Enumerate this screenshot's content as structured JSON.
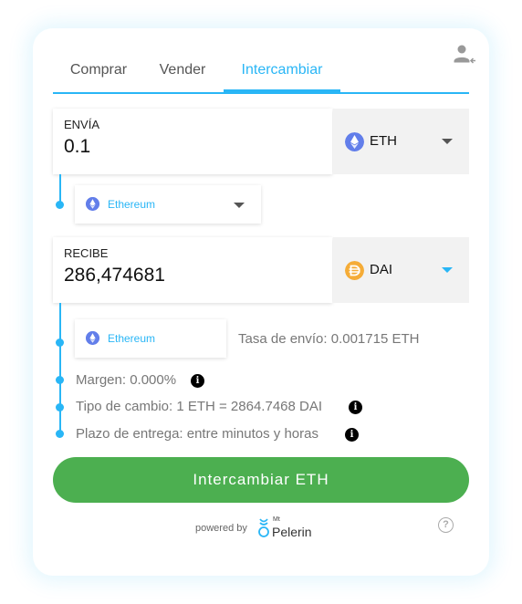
{
  "tabs": [
    {
      "label": "Comprar"
    },
    {
      "label": "Vender"
    },
    {
      "label": "Intercambiar"
    }
  ],
  "send": {
    "label": "ENVÍA",
    "value": "0.1",
    "currency": "ETH",
    "currency_color": "#627eea",
    "network": "Ethereum"
  },
  "receive": {
    "label": "RECIBE",
    "value": "286,474681",
    "currency": "DAI",
    "currency_color": "#f5ac37",
    "network": "Ethereum"
  },
  "info": {
    "network_fee": "Tasa de envío: 0.001715 ETH",
    "margin": "Margen: 0.000%",
    "exchange_rate": "Tipo de cambio: 1 ETH = 2864.7468 DAI",
    "delivery": "Plazo de entrega: entre minutos y horas",
    "info_glyph": "i"
  },
  "cta": {
    "label": "Intercambiar ETH"
  },
  "footer": {
    "powered_by": "powered by",
    "logo_mt": "Mt",
    "logo_name": "Pelerin",
    "help_glyph": "?"
  },
  "colors": {
    "accent": "#29b6f6",
    "cta": "#4caf50"
  }
}
